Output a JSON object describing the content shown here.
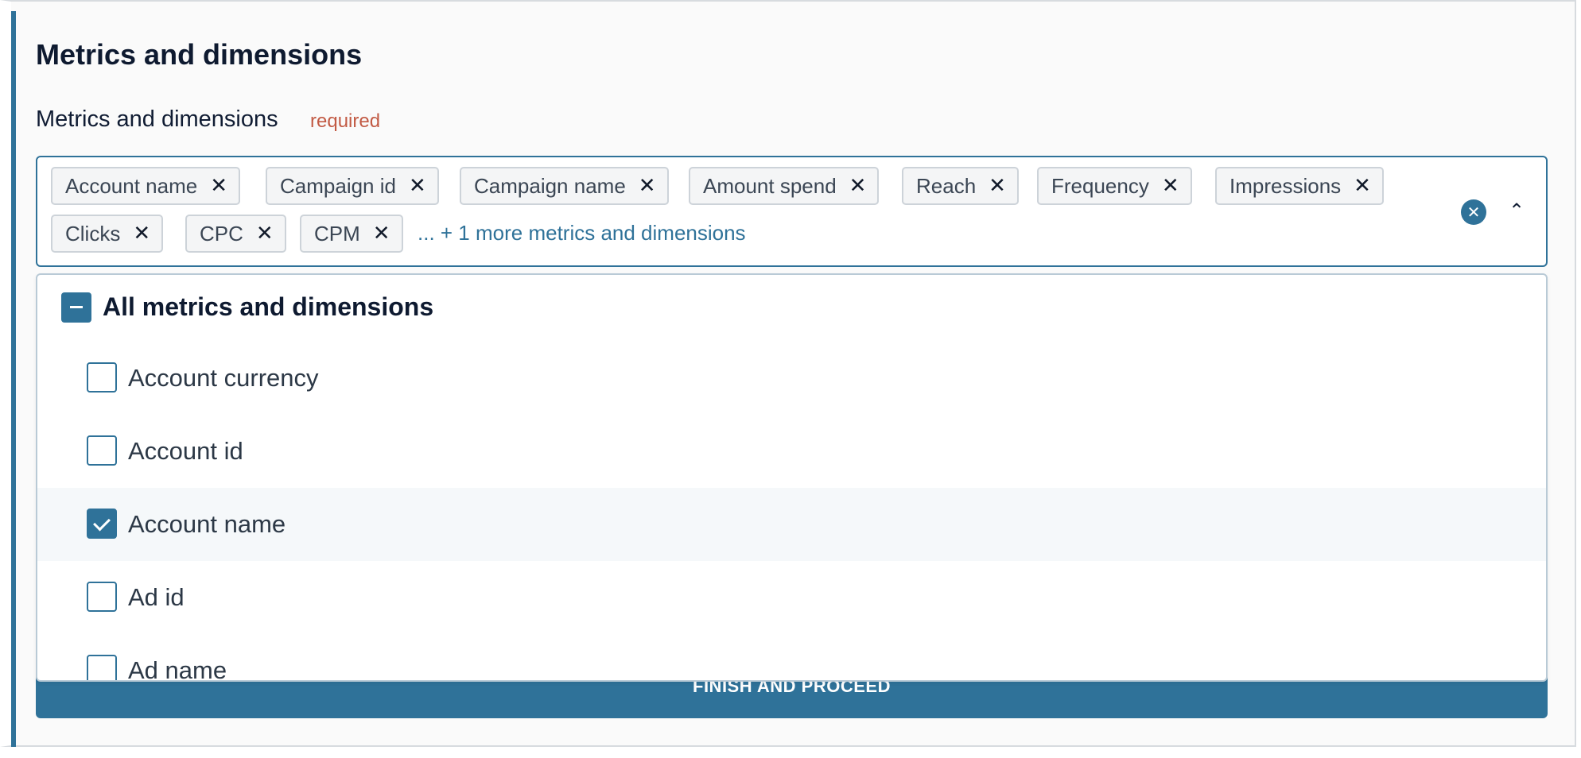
{
  "section": {
    "title": "Metrics and dimensions",
    "field_label": "Metrics and dimensions",
    "required_text": "required"
  },
  "select": {
    "chips": [
      {
        "label": "Account name"
      },
      {
        "label": "Campaign id"
      },
      {
        "label": "Campaign name"
      },
      {
        "label": "Amount spend"
      },
      {
        "label": "Reach"
      },
      {
        "label": "Frequency"
      },
      {
        "label": "Impressions"
      },
      {
        "label": "Clicks"
      },
      {
        "label": "CPC"
      },
      {
        "label": "CPM"
      }
    ],
    "remove_glyph": "✕",
    "more_text": "... + 1 more metrics and dimensions",
    "clear_glyph": "✕",
    "chevron_glyph": "⌃"
  },
  "dropdown": {
    "all_label": "All metrics and dimensions",
    "all_state": "indeterminate",
    "options": [
      {
        "label": "Account currency",
        "checked": false
      },
      {
        "label": "Account id",
        "checked": false
      },
      {
        "label": "Account name",
        "checked": true
      },
      {
        "label": "Ad id",
        "checked": false
      },
      {
        "label": "Ad name",
        "checked": false
      }
    ]
  },
  "footer": {
    "finish_label": "FINISH AND PROCEED"
  },
  "colors": {
    "accent": "#2f7299",
    "required": "#c25a44"
  },
  "icons": {
    "chip_remove": "close-icon",
    "clear_all": "clear-circle-icon",
    "collapse": "chevron-up-icon"
  }
}
